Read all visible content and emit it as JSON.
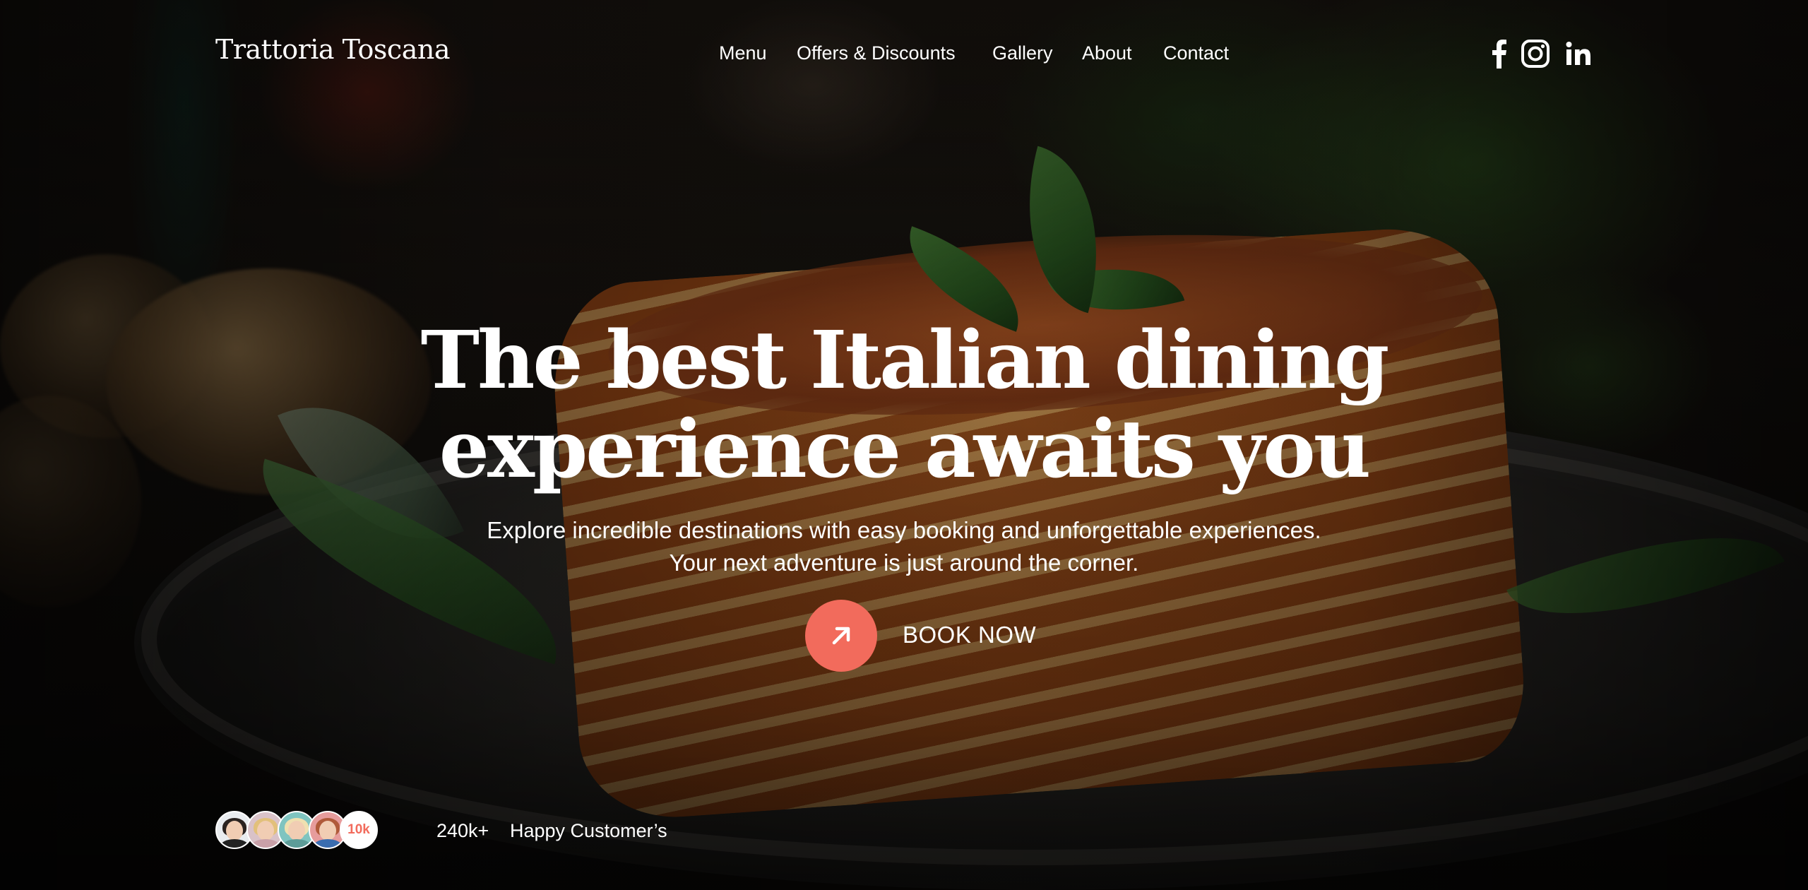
{
  "brand": {
    "name": "Trattoria Toscana"
  },
  "nav": {
    "items": [
      {
        "label": "Menu"
      },
      {
        "label": "Offers & Discounts"
      },
      {
        "label": "Gallery"
      },
      {
        "label": "About"
      },
      {
        "label": "Contact"
      }
    ]
  },
  "social": {
    "icons": [
      "facebook-icon",
      "instagram-icon",
      "linkedin-icon"
    ]
  },
  "hero": {
    "title_line1": "The best Italian dining",
    "title_line2": "experience awaits you",
    "subtitle_line1": "Explore incredible destinations with easy booking and unforgettable experiences.",
    "subtitle_line2": "Your next adventure is just around the corner.",
    "cta_label": "BOOK NOW",
    "cta_icon": "arrow-up-right-icon"
  },
  "stats": {
    "avatar_count_badge": "10k",
    "customers_number": "240k+",
    "customers_label": "Happy Customer’s"
  },
  "colors": {
    "accent": "#f26b5c",
    "text": "#ffffff"
  }
}
